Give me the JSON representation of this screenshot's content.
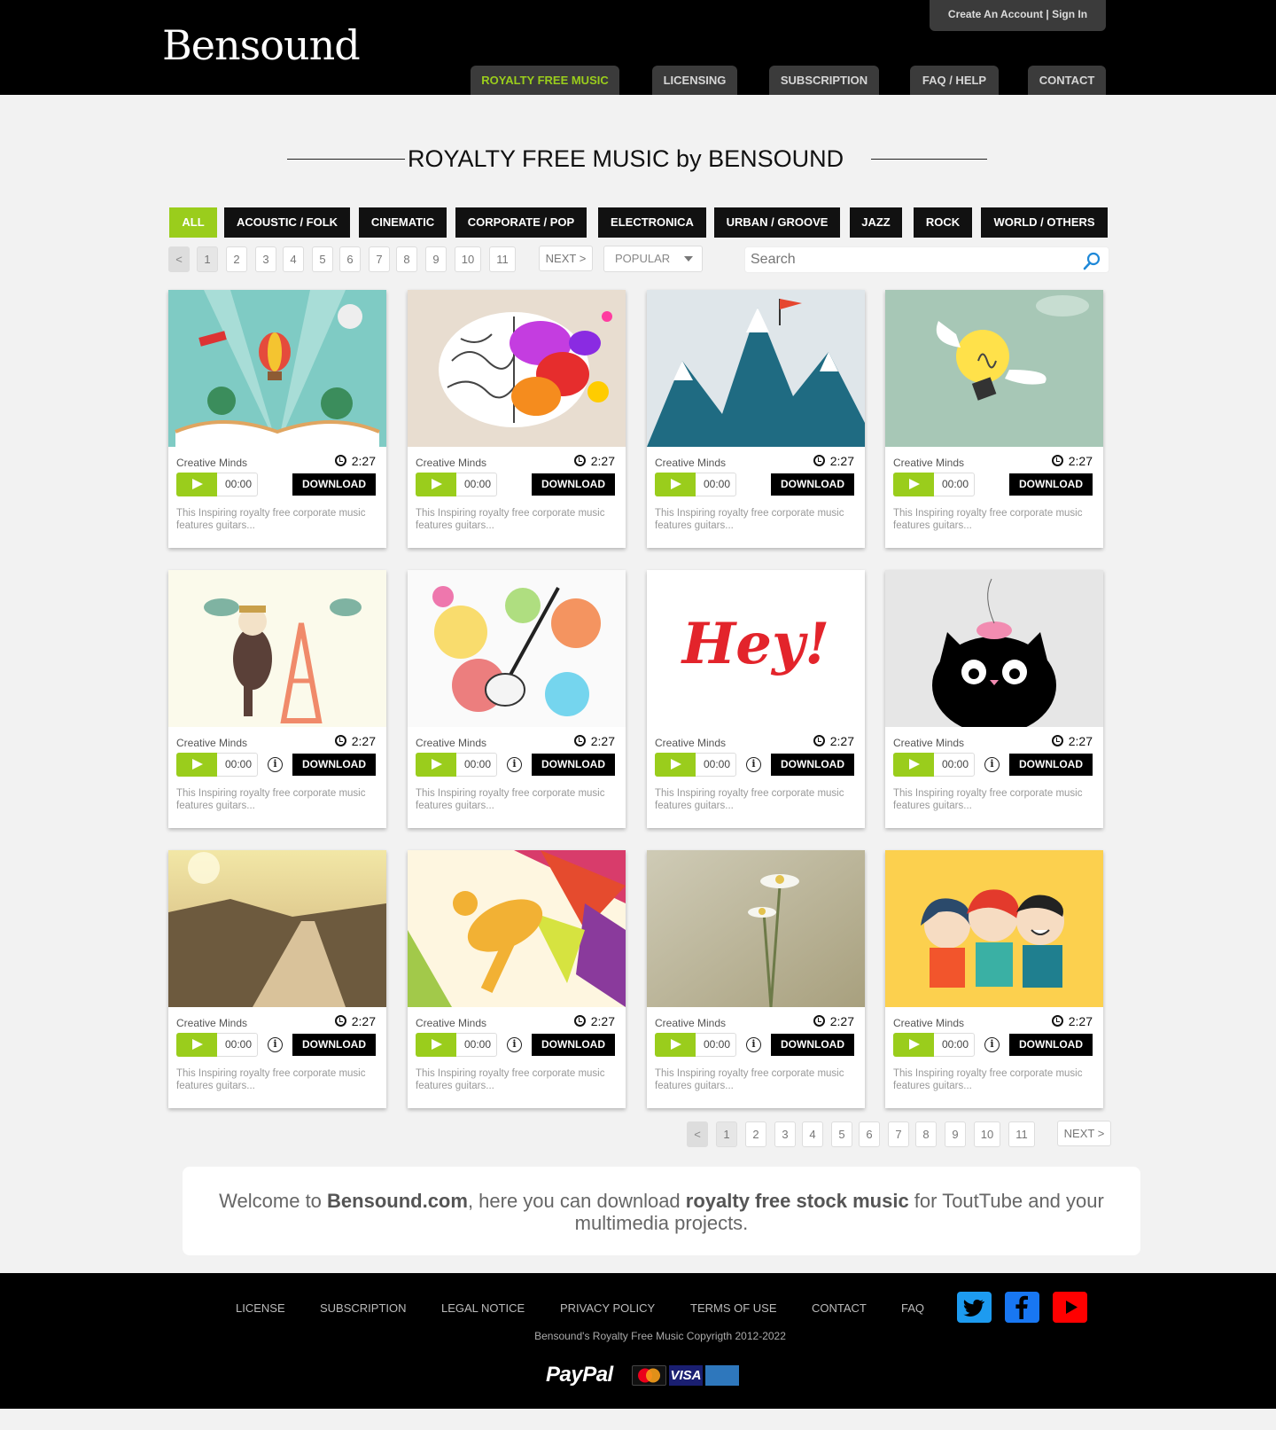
{
  "header": {
    "logo_text": "Bensound",
    "account_link": "Create An Account | Sign In",
    "nav": [
      "ROYALTY FREE MUSIC",
      "LICENSING",
      "SUBSCRIPTION",
      "FAQ / HELP",
      "CONTACT"
    ],
    "active_nav": "ROYALTY FREE MUSIC"
  },
  "page_title": "ROYALTY FREE MUSIC by BENSOUND",
  "categories": [
    "ALL",
    "ACOUSTIC / FOLK",
    "CINEMATIC",
    "CORPORATE / POP",
    "ELECTRONICA",
    "URBAN / GROOVE",
    "JAZZ",
    "ROCK",
    "WORLD / OTHERS"
  ],
  "active_category": "ALL",
  "pagination": {
    "prev": "<",
    "pages": [
      "1",
      "2",
      "3",
      "4",
      "5",
      "6",
      "7",
      "8",
      "9",
      "10",
      "11"
    ],
    "current": "1",
    "next": "NEXT >"
  },
  "sort": {
    "selected": "POPULAR"
  },
  "search": {
    "placeholder": "Search"
  },
  "tracks": [
    {
      "artist": "Creative Minds",
      "duration": "2:27",
      "time": "00:00",
      "download": "DOWNLOAD",
      "desc": "This Inspiring royalty free corporate music features guitars...",
      "art": "book"
    },
    {
      "artist": "Creative Minds",
      "duration": "2:27",
      "time": "00:00",
      "download": "DOWNLOAD",
      "desc": "This Inspiring royalty free corporate music features guitars...",
      "art": "brain"
    },
    {
      "artist": "Creative Minds",
      "duration": "2:27",
      "time": "00:00",
      "download": "DOWNLOAD",
      "desc": "This Inspiring royalty free corporate music features guitars...",
      "art": "mountain"
    },
    {
      "artist": "Creative Minds",
      "duration": "2:27",
      "time": "00:00",
      "download": "DOWNLOAD",
      "desc": "This Inspiring royalty free corporate music features guitars...",
      "art": "bulb"
    },
    {
      "artist": "Creative Minds",
      "duration": "2:27",
      "time": "00:00",
      "download": "DOWNLOAD",
      "desc": "This Inspiring royalty free corporate music features guitars...",
      "art": "paris"
    },
    {
      "artist": "Creative Minds",
      "duration": "2:27",
      "time": "00:00",
      "download": "DOWNLOAD",
      "desc": "This Inspiring royalty free corporate music features guitars...",
      "art": "guitar"
    },
    {
      "artist": "Creative Minds",
      "duration": "2:27",
      "time": "00:00",
      "download": "DOWNLOAD",
      "desc": "This Inspiring royalty free corporate music features guitars...",
      "art": "hey",
      "art_text": "Hey!"
    },
    {
      "artist": "Creative Minds",
      "duration": "2:27",
      "time": "00:00",
      "download": "DOWNLOAD",
      "desc": "This Inspiring royalty free corporate music features guitars...",
      "art": "cat"
    },
    {
      "artist": "Creative Minds",
      "duration": "2:27",
      "time": "00:00",
      "download": "DOWNLOAD",
      "desc": "This Inspiring royalty free corporate music features guitars...",
      "art": "road"
    },
    {
      "artist": "Creative Minds",
      "duration": "2:27",
      "time": "00:00",
      "download": "DOWNLOAD",
      "desc": "This Inspiring royalty free corporate music features guitars...",
      "art": "runner"
    },
    {
      "artist": "Creative Minds",
      "duration": "2:27",
      "time": "00:00",
      "download": "DOWNLOAD",
      "desc": "This Inspiring royalty free corporate music features guitars...",
      "art": "flower"
    },
    {
      "artist": "Creative Minds",
      "duration": "2:27",
      "time": "00:00",
      "download": "DOWNLOAD",
      "desc": "This Inspiring royalty free corporate music features guitars...",
      "art": "friends"
    }
  ],
  "welcome": {
    "t1": "Welcome to ",
    "b1": "Bensound.com",
    "t2": ", here you can download ",
    "b2": "royalty free stock music",
    "t3": " for ToutTube and your multimedia projects."
  },
  "footer": {
    "links": [
      "LICENSE",
      "SUBSCRIPTION",
      "LEGAL NOTICE",
      "PRIVACY POLICY",
      "TERMS OF USE",
      "CONTACT",
      "FAQ"
    ],
    "copyright": "Bensound's Royalty Free Music Copyrigth  2012-2022",
    "social": [
      "twitter-icon",
      "facebook-icon",
      "youtube-icon"
    ],
    "payment": {
      "paypal": "PayPal",
      "mastercard": "MasterCard",
      "visa": "VISA",
      "amex": "AMERICAN EXPRESS"
    }
  },
  "colors": {
    "accent": "#9acd1c",
    "header_bg": "#000000",
    "tab_bg": "#3b3b3b",
    "twitter": "#1d9bf0",
    "facebook": "#1877f2",
    "youtube": "#ff0000"
  }
}
